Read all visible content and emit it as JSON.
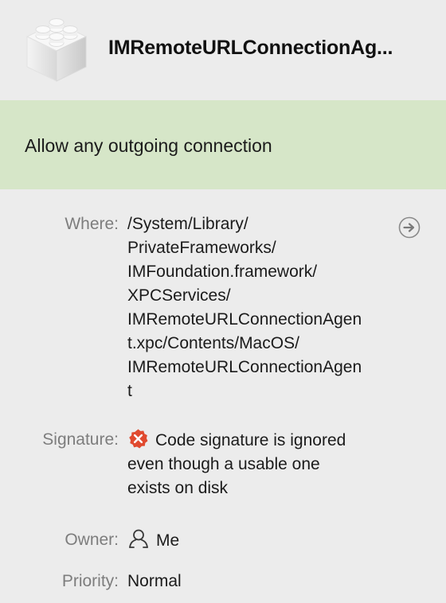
{
  "header": {
    "app_name": "IMRemoteURLConnectionAg...",
    "icon": "lego-brick-icon"
  },
  "rule": {
    "action_text": "Allow any outgoing connection",
    "background_color": "#d6e6c8"
  },
  "details": {
    "where": {
      "label": "Where:",
      "path_lines": [
        "/System/Library/",
        "PrivateFrameworks/",
        "IMFoundation.framework/",
        "XPCServices/",
        "IMRemoteURLConnectionAgen",
        "t.xpc/Contents/MacOS/",
        "IMRemoteURLConnectionAgen",
        "t"
      ],
      "reveal_icon": "arrow-right-circle-icon"
    },
    "signature": {
      "label": "Signature:",
      "lines": [
        "Code signature is ignored",
        "even though a usable one",
        "exists on disk"
      ],
      "status_icon": "error-badge-icon",
      "status_color": "#e04a2f"
    },
    "owner": {
      "label": "Owner:",
      "value": "Me",
      "icon": "user-icon"
    },
    "priority": {
      "label": "Priority:",
      "value": "Normal"
    }
  }
}
